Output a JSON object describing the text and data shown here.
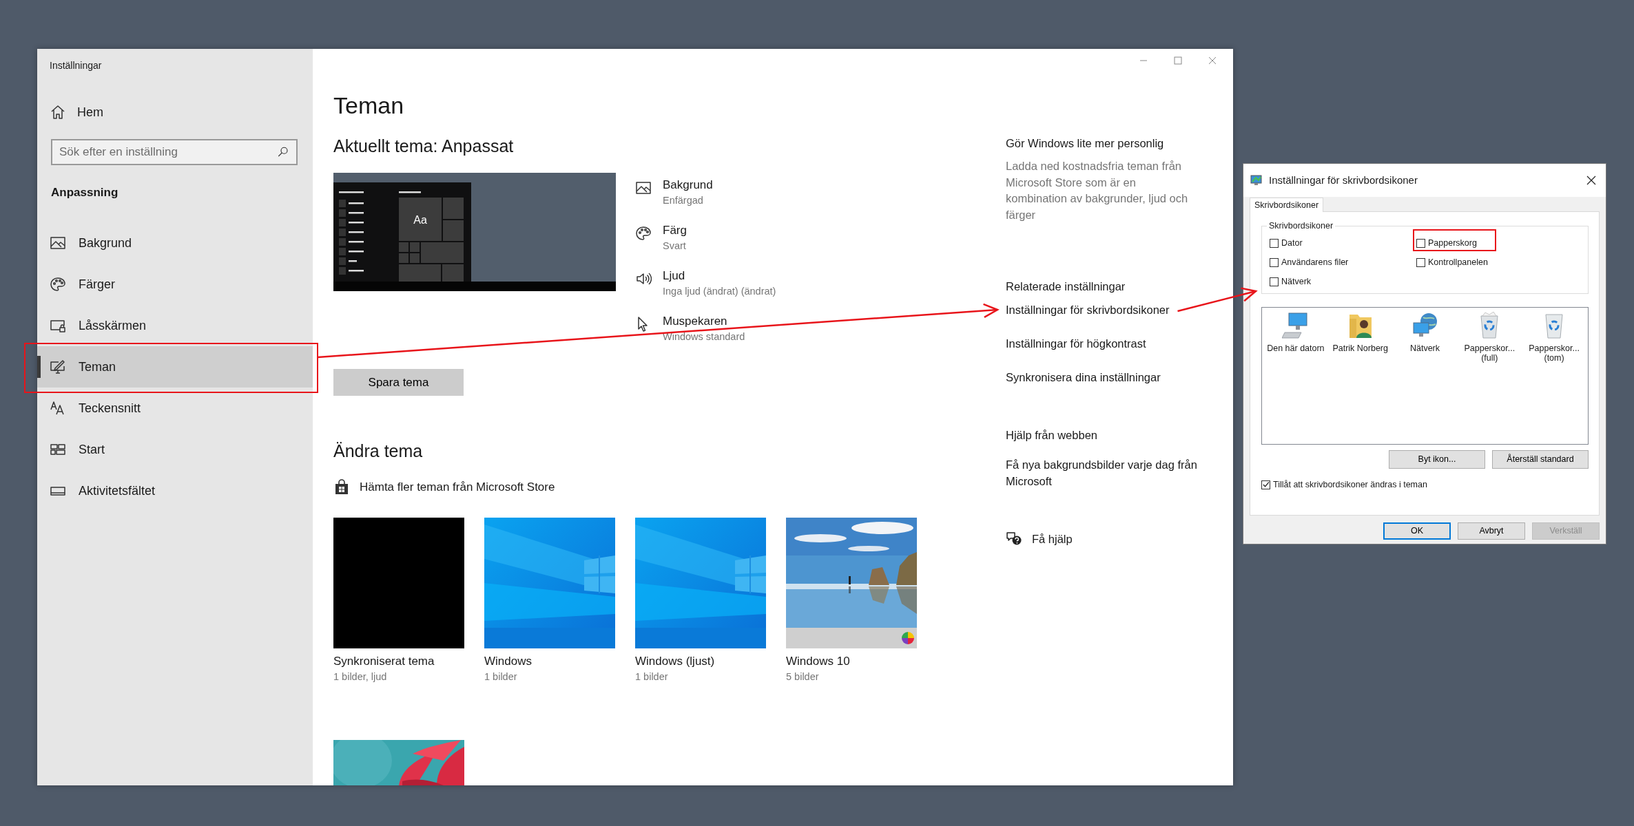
{
  "settings_window": {
    "title": "Inställningar"
  },
  "sidebar": {
    "home": "Hem",
    "search": {
      "placeholder": "Sök efter en inställning"
    },
    "section": "Anpassning",
    "items": [
      {
        "label": "Bakgrund",
        "selected": false,
        "highlighted": false
      },
      {
        "label": "Färger",
        "selected": false,
        "highlighted": false
      },
      {
        "label": "Låsskärmen",
        "selected": false,
        "highlighted": false
      },
      {
        "label": "Teman",
        "selected": true,
        "highlighted": true
      },
      {
        "label": "Teckensnitt",
        "selected": false,
        "highlighted": false
      },
      {
        "label": "Start",
        "selected": false,
        "highlighted": false
      },
      {
        "label": "Aktivitetsfältet",
        "selected": false,
        "highlighted": false
      }
    ]
  },
  "page": {
    "title": "Teman",
    "current_theme": "Aktuellt tema: Anpassat",
    "preview_tile": "Aa",
    "properties": [
      {
        "title": "Bakgrund",
        "value": "Enfärgad"
      },
      {
        "title": "Färg",
        "value": "Svart"
      },
      {
        "title": "Ljud",
        "value": "Inga ljud (ändrat) (ändrat)"
      },
      {
        "title": "Muspekaren",
        "value": "Windows standard"
      }
    ],
    "save_button": "Spara tema",
    "change_heading": "Ändra tema",
    "store_link": "Hämta fler teman från Microsoft Store",
    "themes": [
      {
        "kind": "solid",
        "name": "Synkroniserat tema",
        "detail": "1 bilder, ljud"
      },
      {
        "kind": "picture",
        "name": "Windows",
        "detail": "1 bilder"
      },
      {
        "kind": "picture",
        "name": "Windows (ljust)",
        "detail": "1 bilder"
      },
      {
        "kind": "picture",
        "name": "Windows 10",
        "detail": "5 bilder"
      },
      {
        "kind": "picture"
      }
    ]
  },
  "side_panel": {
    "personalize_heading": "Gör Windows lite mer personlig",
    "personalize_text": "Ladda ned kostnadsfria teman från Microsoft Store som är en kombination av bakgrunder, ljud och färger",
    "related_heading": "Relaterade inställningar",
    "related_links": [
      "Inställningar för skrivbordsikoner",
      "Inställningar för högkontrast",
      "Synkronisera dina inställningar"
    ],
    "web_help_heading": "Hjälp från webben",
    "web_help_link": "Få nya bakgrundsbilder varje dag från Microsoft",
    "help_link": "Få hjälp"
  },
  "dialog": {
    "title": "Inställningar för skrivbordsikoner",
    "tab": {
      "label": "Skrivbordsikoner",
      "selected": true
    },
    "group_label": "Skrivbordsikoner",
    "checkboxes": [
      {
        "label": "Dator",
        "checked": false,
        "highlighted": false
      },
      {
        "label": "Papperskorg",
        "checked": false,
        "highlighted": true
      },
      {
        "label": "Användarens filer",
        "checked": false,
        "highlighted": false
      },
      {
        "label": "Kontrollpanelen",
        "checked": false,
        "highlighted": false
      },
      {
        "label": "Nätverk",
        "checked": false,
        "highlighted": false
      }
    ],
    "icons": [
      {
        "label": "Den här datorn"
      },
      {
        "label": "Patrik Norberg"
      },
      {
        "label": "Nätverk"
      },
      {
        "label": "Papperskor... (full)"
      },
      {
        "label": "Papperskor... (tom)"
      }
    ],
    "change_icon_button": "Byt ikon...",
    "restore_button": "Återställ standard",
    "allow_themes": {
      "label": "Tillåt att skrivbordsikoner ändras i teman",
      "checked": true
    },
    "buttons": [
      {
        "label": "OK",
        "default": true,
        "disabled": false
      },
      {
        "label": "Avbryt",
        "default": false,
        "disabled": false
      },
      {
        "label": "Verkställ",
        "default": false,
        "disabled": true
      }
    ]
  }
}
